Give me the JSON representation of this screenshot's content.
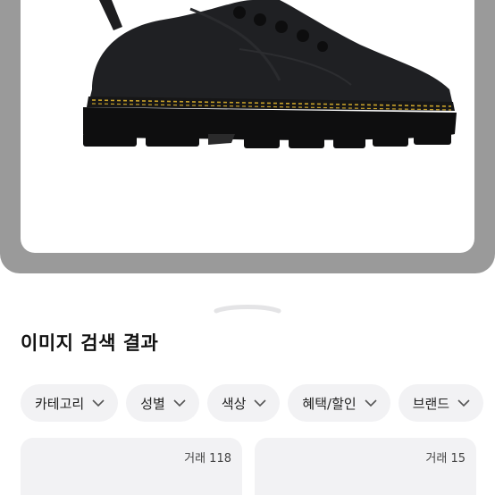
{
  "search": {
    "section_title": "이미지 검색 결과"
  },
  "filters": [
    {
      "label": "카테고리"
    },
    {
      "label": "성별"
    },
    {
      "label": "색상"
    },
    {
      "label": "혜택/할인"
    },
    {
      "label": "브랜드"
    }
  ],
  "results": [
    {
      "trade": "거래 118"
    },
    {
      "trade": "거래 15"
    }
  ],
  "icons": {
    "filter_chevron": "chevron-down-icon",
    "sheet_handle": "drag-handle"
  },
  "colors": {
    "preview_backdrop": "#9a9a9a",
    "chip_background": "#f2f2f4"
  }
}
